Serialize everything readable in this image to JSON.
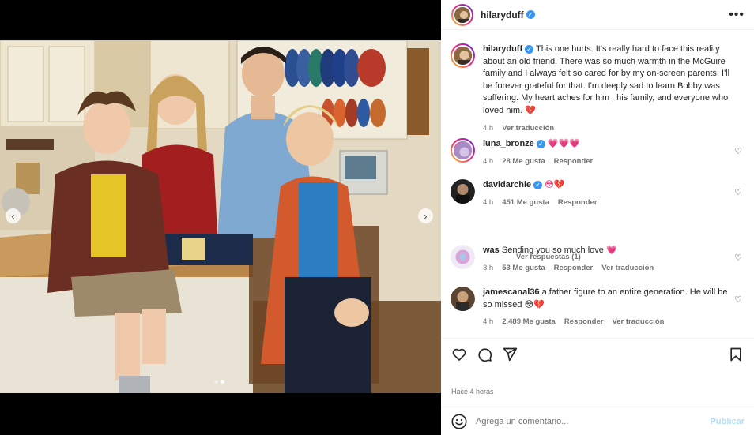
{
  "post": {
    "username": "hilaryduff",
    "more_icon": "more-horizontal-icon",
    "time_ago": "Hace 4 horas"
  },
  "carousel": {
    "prev_icon": "chevron-left-icon",
    "next_icon": "chevron-right-icon",
    "slides": 2,
    "active_slide": 2
  },
  "caption": {
    "username": "hilaryduff",
    "text": "This one hurts. It's really hard to face this reality about an old friend. There was so much warmth in the McGuire family and I always felt so cared for by my on-screen parents. I'll be forever grateful for that. I'm deeply sad to learn Bobby was suffering. My heart aches for him , his family, and everyone who loved him. 💔",
    "time": "4 h",
    "translate": "Ver traducción"
  },
  "comments": [
    {
      "username": "luna_bronze",
      "verified": true,
      "text": "💗💗💗",
      "time": "4 h",
      "likes": "28 Me gusta",
      "reply": "Responder",
      "translate": ""
    },
    {
      "username": "davidarchie",
      "verified": true,
      "text": "😳💔",
      "time": "4 h",
      "likes": "451 Me gusta",
      "reply": "Responder",
      "translate": ""
    },
    {
      "username": "was",
      "verified": false,
      "text": "Sending you so much love 💗",
      "time": "3 h",
      "likes": "53 Me gusta",
      "reply": "Responder",
      "translate": "Ver traducción"
    },
    {
      "username": "jamescanal36",
      "verified": false,
      "text": "a father figure to an entire generation. He will be so missed 😳💔",
      "time": "4 h",
      "likes": "2.489 Me gusta",
      "reply": "Responder",
      "translate": "Ver traducción"
    }
  ],
  "view_replies": "Ver respuestas (1)",
  "actions": {
    "like_icon": "heart-icon",
    "comment_icon": "comment-icon",
    "share_icon": "send-icon",
    "save_icon": "bookmark-icon"
  },
  "add_comment": {
    "emoji_icon": "smiley-icon",
    "placeholder": "Agrega un comentario...",
    "publish": "Publicar"
  },
  "colors": {
    "accent": "#3897f0",
    "publish_disabled": "#b2dffc",
    "heart_emoji": "#e0245e",
    "muted_text": "#737373"
  }
}
